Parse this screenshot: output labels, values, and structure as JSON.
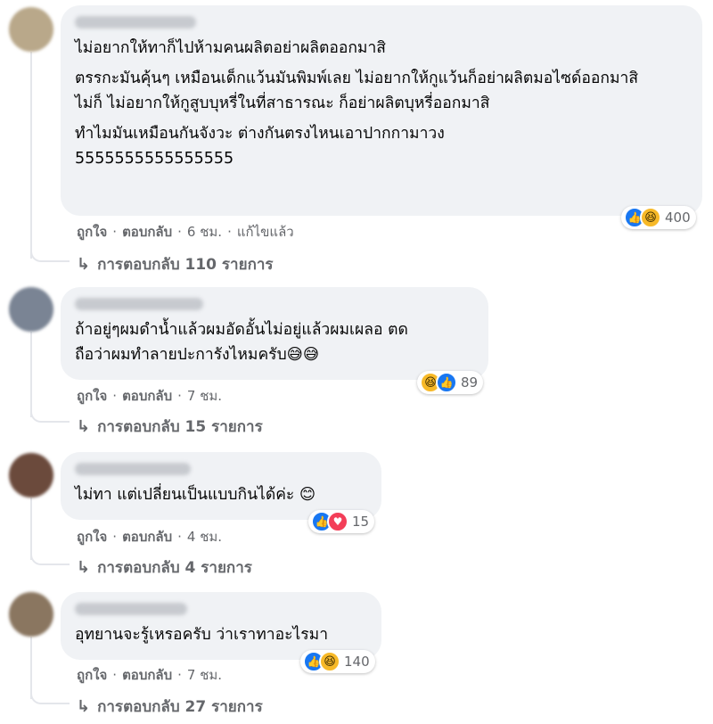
{
  "comments": [
    {
      "paragraphs": [
        "ไม่อยากให้ทาก็ไปห้ามคนผลิตอย่าผลิตออกมาสิ",
        "ตรรกะมันคุ้นๆ เหมือนเด็กแว้นมันพิมพ์เลย ไม่อยากให้กูแว้นก็อย่าผลิตมอไซด์ออกมาสิ\nไม่ก็ ไม่อยากให้กูสูบบุหรี่ในที่สาธารณะ ก็อย่าผลิตบุหรี่ออกมาสิ",
        "ทำไมมันเหมือนกันจังวะ ต่างกันตรงไหนเอาปากกามาวง\n5555555555555555"
      ],
      "reactions": [
        "like",
        "haha"
      ],
      "reaction_count": "400",
      "like_label": "ถูกใจ",
      "reply_label": "ตอบกลับ",
      "time": "6 ชม.",
      "edited": "แก้ไขแล้ว",
      "replies_text": "การตอบกลับ 110 รายการ",
      "avatar_color": "#b9a88a"
    },
    {
      "paragraphs": [
        "ถ้าอยู่ๆผมดำน้ำแล้วผมอัดอั้นไม่อยู่แล้วผมเผลอ ตด\nถือว่าผมทำลายปะการังไหมครับ😅😅"
      ],
      "reactions": [
        "haha",
        "like"
      ],
      "reaction_count": "89",
      "like_label": "ถูกใจ",
      "reply_label": "ตอบกลับ",
      "time": "7 ชม.",
      "replies_text": "การตอบกลับ 15 รายการ",
      "avatar_color": "#7a8494"
    },
    {
      "paragraphs": [
        "ไม่ทา แต่เปลี่ยนเป็นแบบกินได้ค่ะ 😊"
      ],
      "reactions": [
        "like",
        "love"
      ],
      "reaction_count": "15",
      "like_label": "ถูกใจ",
      "reply_label": "ตอบกลับ",
      "time": "4 ชม.",
      "replies_text": "การตอบกลับ 4 รายการ",
      "avatar_color": "#6b4a3c"
    },
    {
      "paragraphs": [
        "อุทยานจะรู้เหรอครับ ว่าเราทาอะไรมา"
      ],
      "reactions": [
        "like",
        "haha"
      ],
      "reaction_count": "140",
      "like_label": "ถูกใจ",
      "reply_label": "ตอบกลับ",
      "time": "7 ชม.",
      "replies_text": "การตอบกลับ 27 รายการ",
      "avatar_color": "#8a7660"
    }
  ],
  "icons": {
    "like": "like-reaction-icon",
    "haha": "haha-reaction-icon",
    "love": "love-reaction-icon",
    "reply_arrow": "reply-arrow-icon"
  },
  "colors": {
    "bubble": "#f0f2f5",
    "meta_text": "#65676b",
    "like": "#1877f2",
    "love": "#f33e58",
    "haha": "#f7b928"
  }
}
